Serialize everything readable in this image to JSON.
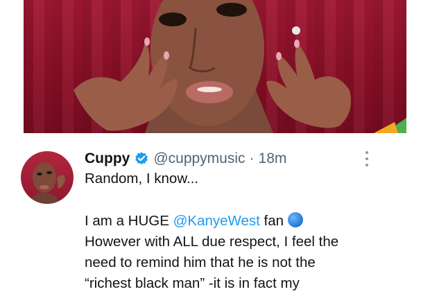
{
  "photo": {
    "icon": "photo-of-woman"
  },
  "tweet": {
    "author": {
      "name": "Cuppy",
      "handle": "@cuppymusic",
      "separator": "·",
      "time": "18m",
      "verified_icon": "verified-badge-icon",
      "avatar_icon": "avatar-photo"
    },
    "more_icon": "more-options-icon",
    "lines": {
      "l1": "Random, I know...",
      "l2_prefix": "I am a HUGE ",
      "l2_mention": "@KanyeWest",
      "l2_suffix": " fan",
      "l2_emoji": "blue-circle-emoji",
      "l3": "However with ALL due respect, I feel the",
      "l4": "need to remind him that he is not the",
      "l5": "“richest black man” -it is in fact my"
    },
    "colors": {
      "link": "#1d9bf0",
      "verified": "#1d9bf0",
      "secondary_text": "#536471",
      "backdrop": "#8a0f27"
    }
  }
}
